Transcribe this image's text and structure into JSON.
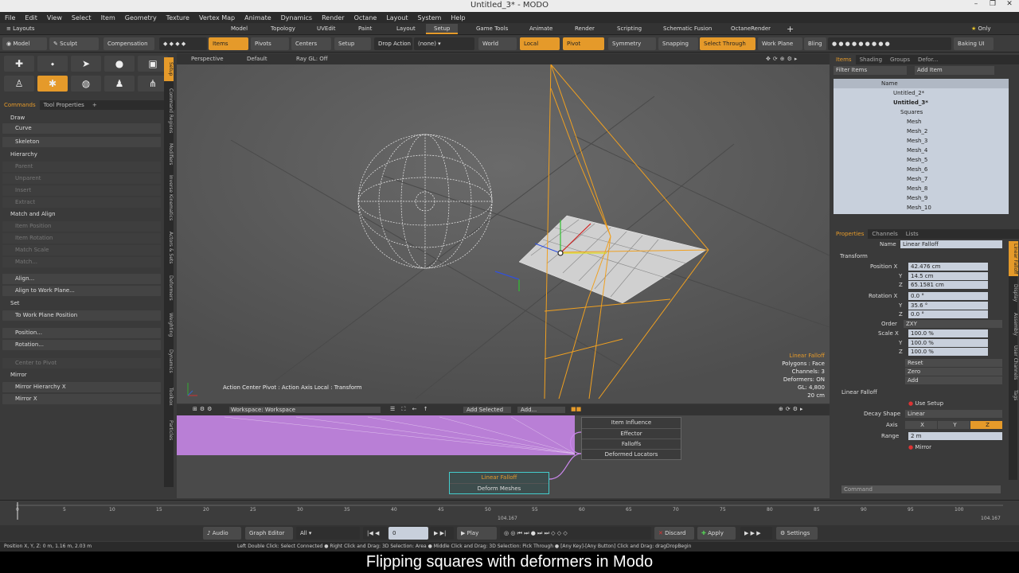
{
  "window": {
    "title": "Untitled_3* - MODO"
  },
  "menu": [
    "File",
    "Edit",
    "View",
    "Select",
    "Item",
    "Geometry",
    "Texture",
    "Vertex Map",
    "Animate",
    "Dynamics",
    "Render",
    "Octane",
    "Layout",
    "System",
    "Help"
  ],
  "layouts_label": "Layouts",
  "layout_tabs": [
    "Model",
    "Topology",
    "UVEdit",
    "Paint",
    "Layout",
    "Setup",
    "Game Tools",
    "Animate",
    "Render",
    "Scripting",
    "Schematic Fusion",
    "OctaneRender"
  ],
  "layout_active": "Setup",
  "only_label": "Only",
  "toolbar": {
    "model": "Model",
    "sculpt": "Sculpt",
    "compensation": "Compensation",
    "items": "Items",
    "pivots": "Pivots",
    "centers": "Centers",
    "setup": "Setup",
    "drop_action": "Drop Action",
    "drop_value": "(none)",
    "world": "World",
    "local": "Local",
    "pivot": "Pivot",
    "symmetry": "Symmetry",
    "snapping": "Snapping",
    "select_through": "Select Through",
    "work_plane": "Work Plane",
    "bling": "Bling",
    "baking_ui": "Baking UI"
  },
  "left": {
    "tabs": [
      "Commands",
      "Tool Properties"
    ],
    "sections": {
      "draw": "Draw",
      "curve": "Curve",
      "skeleton": "Skeleton",
      "hierarchy": "Hierarchy",
      "parent": "Parent",
      "unparent": "Unparent",
      "insert": "Insert",
      "extract": "Extract",
      "match_align": "Match and Align",
      "item_position": "Item Position",
      "item_rotation": "Item Rotation",
      "match_scale": "Match Scale",
      "match": "Match...",
      "align": "Align...",
      "align_work_plane": "Align to Work Plane...",
      "set": "Set",
      "to_work_plane_position": "To Work Plane Position",
      "position": "Position...",
      "rotation": "Rotation...",
      "center_to_pivot": "Center to Pivot",
      "mirror": "Mirror",
      "mirror_hierarchy_x": "Mirror Hierarchy X",
      "mirror_x": "Mirror X"
    },
    "side_tabs": [
      "Setup",
      "Command Regions",
      "Modifiers",
      "Inverse Kinematics",
      "Actors & Sets",
      "Deformers",
      "Weighting",
      "Dynamics",
      "Toolbox",
      "Particles"
    ]
  },
  "viewport": {
    "header": [
      "Perspective",
      "Default",
      "Ray GL: Off"
    ],
    "action_center": "Action Center Pivot : Action Axis Local : Transform",
    "info_title": "Linear Falloff",
    "info_lines": [
      "Polygons : Face",
      "Channels: 3",
      "Deformers: ON",
      "GL: 4,800",
      "20 cm"
    ]
  },
  "node_editor": {
    "workspace": "Workspace: Workspace",
    "add_selected": "Add Selected",
    "add": "Add...",
    "item_influence": {
      "title": "Item Influence",
      "rows": [
        "Effector",
        "Falloffs",
        "Deformed Locators"
      ]
    },
    "linear_falloff": {
      "title": "Linear Falloff",
      "rows": [
        "Deform Meshes"
      ]
    }
  },
  "right": {
    "tabs": [
      "Items",
      "Shading",
      "Groups",
      "Defor..."
    ],
    "filter_items": "Filter Items",
    "add_item": "Add Item",
    "name_header": "Name",
    "items": [
      "Untitled_2*",
      "Untitled_3*",
      "Squares",
      "Mesh",
      "Mesh_2",
      "Mesh_3",
      "Mesh_4",
      "Mesh_5",
      "Mesh_6",
      "Mesh_7",
      "Mesh_8",
      "Mesh_9",
      "Mesh_10"
    ],
    "prop_tabs": [
      "Properties",
      "Channels",
      "Lists"
    ],
    "name_label": "Name",
    "name_value": "Linear Falloff",
    "transform": "Transform",
    "position_label": "Position X",
    "position": [
      "42.476 cm",
      "14.5 cm",
      "65.1581 cm"
    ],
    "rotation_label": "Rotation X",
    "rotation": [
      "0.0 °",
      "35.6 °",
      "0.0 °"
    ],
    "order_label": "Order",
    "order": "ZXY",
    "scale_label": "Scale X",
    "scale": [
      "100.0 %",
      "100.0 %",
      "100.0 %"
    ],
    "y": "Y",
    "z": "Z",
    "reset": "Reset",
    "zero": "Zero",
    "add": "Add",
    "linear_falloff": "Linear Falloff",
    "use_setup": "Use Setup",
    "decay_shape_label": "Decay Shape",
    "decay_shape": "Linear",
    "axis_label": "Axis",
    "axis": [
      "X",
      "Y",
      "Z"
    ],
    "range_label": "Range",
    "range": "2 m",
    "mirror": "Mirror",
    "command_placeholder": "Command",
    "vertical_tabs": [
      "Linear Falloff",
      "Display",
      "Assembly",
      "User Channels",
      "Tags"
    ]
  },
  "timeline": {
    "ticks": [
      "0",
      "5",
      "10",
      "15",
      "20",
      "25",
      "30",
      "35",
      "40",
      "45",
      "50",
      "55",
      "60",
      "65",
      "70",
      "75",
      "80",
      "85",
      "90",
      "95",
      "100"
    ],
    "marker_a": "104.167",
    "marker_b": "104.167"
  },
  "playbar": {
    "audio": "Audio",
    "graph_editor": "Graph Editor",
    "all": "All",
    "frame": "0",
    "play": "Play",
    "discard": "Discard",
    "apply": "Apply",
    "settings": "Settings"
  },
  "status": {
    "left": "Position X, Y, Z:  0 m, 1.16 m, 2.03 m",
    "right": "Left Double Click: Select Connected ● Right Click and Drag: 3D Selection: Area ● Middle Click and Drag: 3D Selection: Pick Through ● [Any Key]-[Any Button] Click and Drag: dragDropBegin"
  },
  "caption": "Flipping squares with deformers in Modo",
  "colors": {
    "accent": "#e59a2a",
    "selection_pink": "#cc88ee"
  }
}
